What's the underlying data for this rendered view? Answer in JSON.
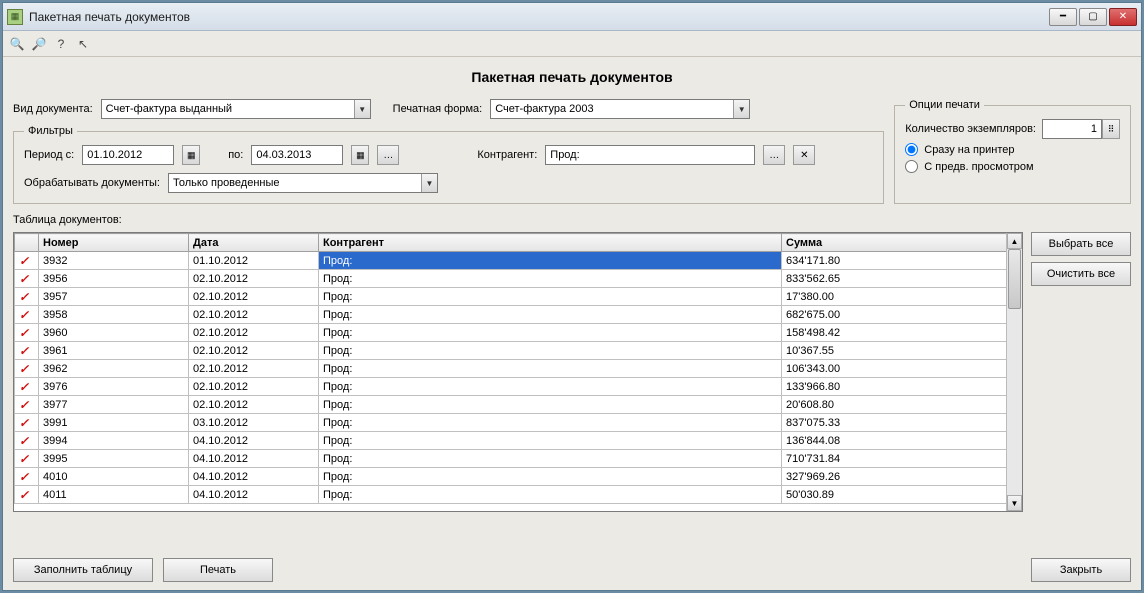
{
  "window": {
    "title": "Пакетная печать документов"
  },
  "page": {
    "heading": "Пакетная печать документов"
  },
  "doc_type": {
    "label": "Вид документа:",
    "value": "Счет-фактура выданный"
  },
  "print_form": {
    "label": "Печатная форма:",
    "value": "Счет-фактура 2003"
  },
  "filters": {
    "legend": "Фильтры",
    "period_from_label": "Период с:",
    "period_from": "01.10.2012",
    "period_to_label": "по:",
    "period_to": "04.03.2013",
    "counterparty_label": "Контрагент:",
    "counterparty": "Прод:",
    "process_label": "Обрабатывать документы:",
    "process_value": "Только проведенные"
  },
  "options": {
    "legend": "Опции печати",
    "copies_label": "Количество экземпляров:",
    "copies": "1",
    "radio1": "Сразу на принтер",
    "radio2": "С предв. просмотром",
    "selected": "radio1"
  },
  "table": {
    "label": "Таблица документов:",
    "columns": [
      "",
      "Номер",
      "Дата",
      "Контрагент",
      "Сумма"
    ],
    "rows": [
      {
        "num": "3932",
        "date": "01.10.2012",
        "contr": "Прод:",
        "sum": "634'171.80",
        "sel": true
      },
      {
        "num": "3956",
        "date": "02.10.2012",
        "contr": "Прод:",
        "sum": "833'562.65"
      },
      {
        "num": "3957",
        "date": "02.10.2012",
        "contr": "Прод:",
        "sum": "17'380.00"
      },
      {
        "num": "3958",
        "date": "02.10.2012",
        "contr": "Прод:",
        "sum": "682'675.00"
      },
      {
        "num": "3960",
        "date": "02.10.2012",
        "contr": "Прод:",
        "sum": "158'498.42"
      },
      {
        "num": "3961",
        "date": "02.10.2012",
        "contr": "Прод:",
        "sum": "10'367.55"
      },
      {
        "num": "3962",
        "date": "02.10.2012",
        "contr": "Прод:",
        "sum": "106'343.00"
      },
      {
        "num": "3976",
        "date": "02.10.2012",
        "contr": "Прод:",
        "sum": "133'966.80"
      },
      {
        "num": "3977",
        "date": "02.10.2012",
        "contr": "Прод:",
        "sum": "20'608.80"
      },
      {
        "num": "3991",
        "date": "03.10.2012",
        "contr": "Прод:",
        "sum": "837'075.33"
      },
      {
        "num": "3994",
        "date": "04.10.2012",
        "contr": "Прод:",
        "sum": "136'844.08"
      },
      {
        "num": "3995",
        "date": "04.10.2012",
        "contr": "Прод:",
        "sum": "710'731.84"
      },
      {
        "num": "4010",
        "date": "04.10.2012",
        "contr": "Прод:",
        "sum": "327'969.26"
      },
      {
        "num": "4011",
        "date": "04.10.2012",
        "contr": "Прод:",
        "sum": "50'030.89"
      }
    ]
  },
  "buttons": {
    "select_all": "Выбрать все",
    "clear_all": "Очистить все",
    "fill": "Заполнить таблицу",
    "print": "Печать",
    "close": "Закрыть"
  }
}
